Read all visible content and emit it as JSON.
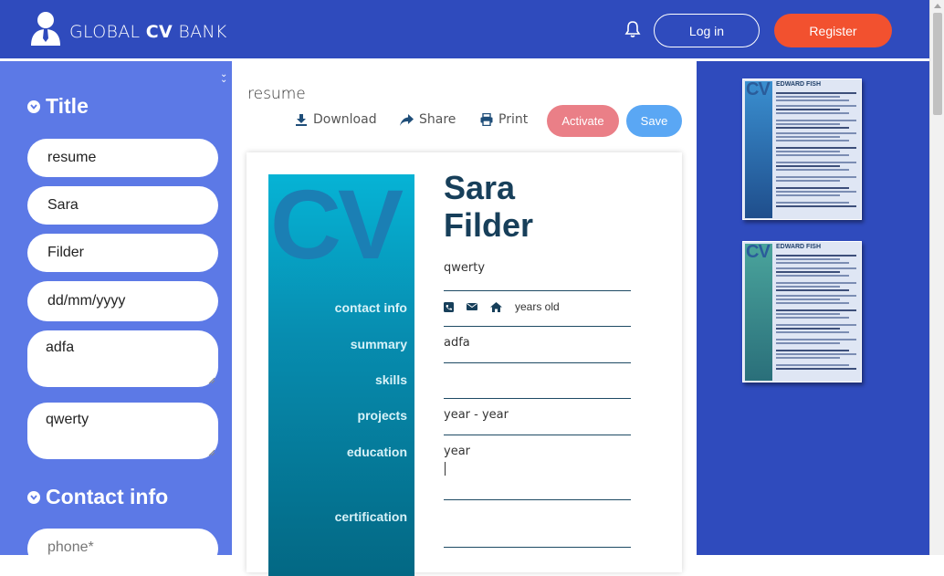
{
  "header": {
    "brand_prefix": "GLOBAL ",
    "brand_bold": "CV",
    "brand_suffix": " BANK",
    "login_label": "Log in",
    "register_label": "Register",
    "bg_color": "#2f4bbd",
    "register_color": "#f2512f"
  },
  "sidebar": {
    "title_section": "Title",
    "fields": {
      "title": "resume",
      "first_name": "Sara",
      "last_name": "Filder",
      "dob_placeholder": "dd/mm/yyyy",
      "summary": "adfa",
      "subtitle": "qwerty"
    },
    "contact_section": "Contact info",
    "phone_placeholder": "phone*"
  },
  "toolbar": {
    "doc_name": "resume",
    "download": "Download",
    "share": "Share",
    "print": "Print",
    "activate": "Activate",
    "save": "Save"
  },
  "cv": {
    "watermark": "CV",
    "first_name": "Sara",
    "last_name": "Filder",
    "subtitle": "qwerty",
    "age_text": "years old",
    "summary": "adfa",
    "projects": "year - year",
    "education": "year",
    "labels": {
      "contact": "contact info",
      "summary": "summary",
      "skills": "skills",
      "projects": "projects",
      "education": "education",
      "certification": "certification"
    }
  },
  "templates": [
    {
      "name": "EDWARD FISH",
      "watermark": "CV",
      "accent": "#1f4e8c"
    },
    {
      "name": "EDWARD FISH",
      "watermark": "CV",
      "accent": "#2a6f7a"
    }
  ]
}
